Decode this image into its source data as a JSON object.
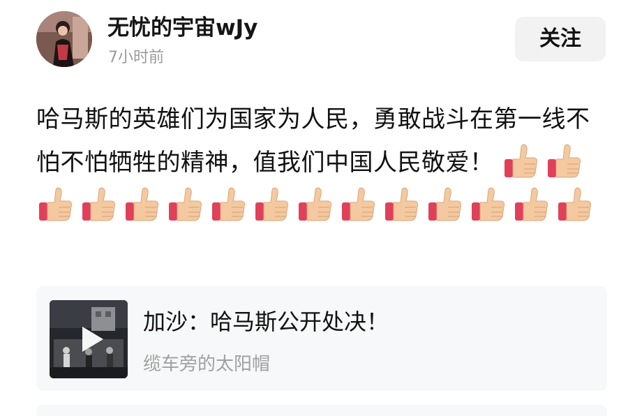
{
  "author": {
    "name": "无忧的宇宙wJy",
    "time": "7小时前",
    "avatar_icon": "avatar-photo"
  },
  "follow_button": {
    "label": "关注"
  },
  "post": {
    "text": "哈马斯的英雄们为国家为人民，勇敢战斗在第一线不怕不怕牺牲的精神，值我们中国人民敬爱！",
    "emoji_icon": "thumbs-up-icon",
    "emoji_count": 15
  },
  "share_card": {
    "title": "加沙：哈马斯公开处决！",
    "author": "缆车旁的太阳帽",
    "play_icon": "play-icon"
  },
  "colors": {
    "timestamp": "#9a9a9a",
    "card_bg": "#f7f8fa",
    "follow_bg": "#f2f2f2",
    "thumb_skin": "#f4c9a0",
    "thumb_cuff": "#e0405a"
  }
}
